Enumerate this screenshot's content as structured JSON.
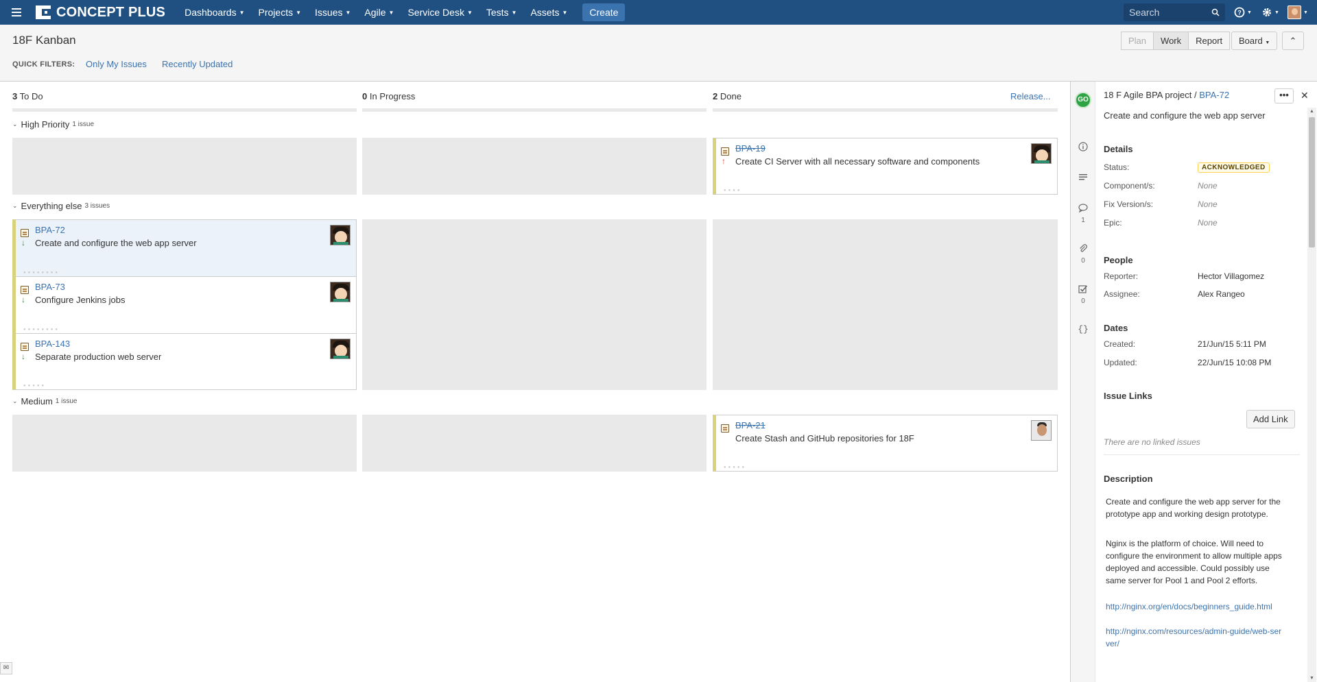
{
  "nav": {
    "logo": "CONCEPT PLUS",
    "items": [
      "Dashboards",
      "Projects",
      "Issues",
      "Agile",
      "Service Desk",
      "Tests",
      "Assets"
    ],
    "create": "Create",
    "search_placeholder": "Search",
    "search_icon": "search-icon",
    "help_icon": "help-icon",
    "settings_icon": "gear-icon",
    "brand_color": "#205081"
  },
  "header": {
    "title": "18F Kanban",
    "quick_filters_label": "QUICK FILTERS:",
    "quick_filters": [
      "Only My Issues",
      "Recently Updated"
    ],
    "modes": [
      "Plan",
      "Work",
      "Report"
    ],
    "board_button": "Board",
    "collapse_icon": "collapse-icon"
  },
  "columns": [
    {
      "count": "3",
      "name": "To Do"
    },
    {
      "count": "0",
      "name": "In Progress"
    },
    {
      "count": "2",
      "name": "Done"
    }
  ],
  "release": "Release...",
  "swimlanes": [
    {
      "name": "High Priority",
      "count": "1 issue"
    },
    {
      "name": "Everything else",
      "count": "3 issues"
    },
    {
      "name": "Medium",
      "count": "1 issue"
    }
  ],
  "cards": [
    {
      "key": "BPA-19",
      "summary": "Create CI Server with all necessary software and components",
      "done": true,
      "priority": "high"
    },
    {
      "key": "BPA-72",
      "summary": "Create and configure the web app server",
      "done": false,
      "priority": "low"
    },
    {
      "key": "BPA-73",
      "summary": "Configure Jenkins jobs",
      "done": false,
      "priority": "low"
    },
    {
      "key": "BPA-143",
      "summary": "Separate production web server",
      "done": false,
      "priority": "low"
    },
    {
      "key": "BPA-21",
      "summary": "Create Stash and GitHub repositories for 18F",
      "done": true,
      "priority": "medium"
    }
  ],
  "detail": {
    "project": "18 F Agile BPA project /",
    "key": "BPA-72",
    "badge": "GO",
    "title": "Create and configure the web app server",
    "sections": {
      "details": "Details",
      "people": "People",
      "dates": "Dates",
      "links": "Issue Links",
      "description": "Description"
    },
    "fields": {
      "status_label": "Status:",
      "status": "ACKNOWLEDGED",
      "components_label": "Component/s:",
      "components": "None",
      "fix_label": "Fix Version/s:",
      "fix": "None",
      "epic_label": "Epic:",
      "epic": "None",
      "reporter_label": "Reporter:",
      "reporter": "Hector Villagomez",
      "assignee_label": "Assignee:",
      "assignee": "Alex Rangeo",
      "created_label": "Created:",
      "created": "21/Jun/15 5:11 PM",
      "updated_label": "Updated:",
      "updated": "22/Jun/15 10:08 PM"
    },
    "add_link": "Add Link",
    "no_links": "There are no linked issues",
    "description_p1": "Create and configure the web app server for the prototype app and working design prototype.",
    "description_p2": "Nginx is the platform of choice. Will need to configure the environment to allow multiple apps deployed and accessible. Could possibly use same server for Pool 1 and Pool 2 efforts.",
    "link1": "http://nginx.org/en/docs/beginners_guide.html",
    "link2": "http://nginx.com/resources/admin-guide/web-server/",
    "side_counts": {
      "comments": "1",
      "attachments": "0",
      "subtasks": "0"
    }
  }
}
